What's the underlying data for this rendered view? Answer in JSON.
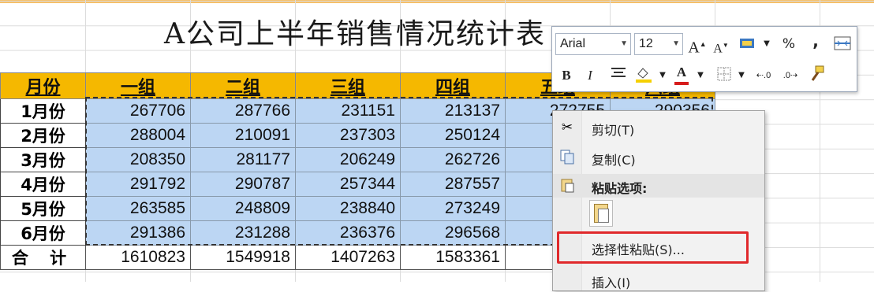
{
  "title": "A公司上半年销售情况统计表",
  "headers": [
    "月份",
    "一组",
    "二组",
    "三组",
    "四组",
    "五组",
    "六组"
  ],
  "rows": [
    {
      "month": "1月份",
      "values": [
        "267706",
        "287766",
        "231151",
        "213137",
        "272755",
        "290356"
      ]
    },
    {
      "month": "2月份",
      "values": [
        "288004",
        "210091",
        "237303",
        "250124",
        "2",
        ""
      ]
    },
    {
      "month": "3月份",
      "values": [
        "208350",
        "281177",
        "206249",
        "262726",
        "2",
        ""
      ]
    },
    {
      "month": "4月份",
      "values": [
        "291792",
        "290787",
        "257344",
        "287557",
        "2",
        ""
      ]
    },
    {
      "month": "5月份",
      "values": [
        "263585",
        "248809",
        "238840",
        "273249",
        "2",
        ""
      ]
    },
    {
      "month": "6月份",
      "values": [
        "291386",
        "231288",
        "236376",
        "296568",
        "2",
        ""
      ]
    }
  ],
  "total": {
    "label": "合 计",
    "values": [
      "1610823",
      "1549918",
      "1407263",
      "1583361",
      "14",
      ""
    ]
  },
  "mini_toolbar": {
    "font_name": "Arial",
    "font_size": "12",
    "grow_font": "A",
    "shrink_font": "A",
    "percent": "%",
    "comma": ",",
    "bold": "B",
    "italic": "I",
    "font_color_letter": "A"
  },
  "context_menu": {
    "cut": "剪切(T)",
    "copy": "复制(C)",
    "paste_options": "粘贴选项:",
    "paste_special": "选择性粘贴(S)...",
    "insert": "插入(I)"
  },
  "colors": {
    "header_fill": "#f5b800",
    "selection_fill": "#bcd6f3",
    "highlight_box": "#e0292b"
  },
  "icons": [
    "cut-icon",
    "copy-icon",
    "paste-icon",
    "paste-option-icon",
    "format-painter-icon",
    "merge-cells-icon"
  ]
}
